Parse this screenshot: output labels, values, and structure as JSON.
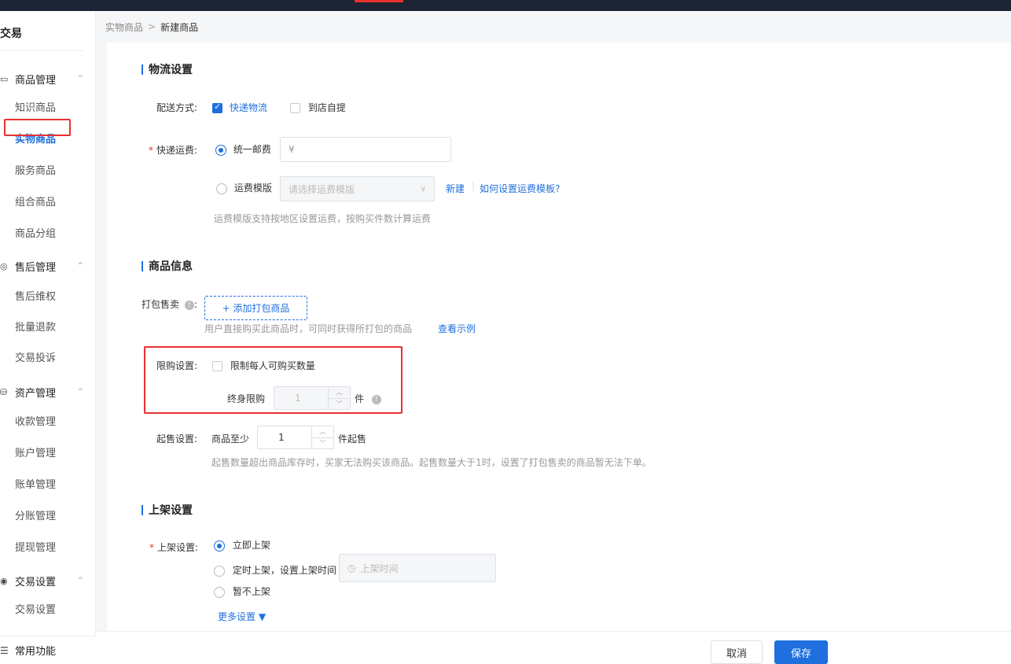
{
  "sidebar": {
    "title": "交易",
    "groups": [
      {
        "label": "商品管理",
        "icon": "▭",
        "items": [
          "知识商品",
          "实物商品",
          "服务商品",
          "组合商品",
          "商品分组"
        ]
      },
      {
        "label": "售后管理",
        "icon": "◎",
        "items": [
          "售后维权",
          "批量退款",
          "交易投诉"
        ]
      },
      {
        "label": "资产管理",
        "icon": "⛁",
        "items": [
          "收款管理",
          "账户管理",
          "账单管理",
          "分账管理",
          "提现管理"
        ]
      },
      {
        "label": "交易设置",
        "icon": "◉",
        "items": [
          "交易设置"
        ]
      }
    ],
    "bottom": {
      "label": "常用功能",
      "icon": "☰"
    },
    "chevron": "^"
  },
  "breadcrumb": {
    "parent": "实物商品",
    "separator": ">",
    "current": "新建商品"
  },
  "logistics": {
    "title": "物流设置",
    "delivery_label": "配送方式:",
    "express_option": "快递物流",
    "pickup_option": "到店自提",
    "fee_label": "快递运费:",
    "flat_fee_option": "统一邮费",
    "currency": "¥",
    "template_option": "运费模版",
    "template_placeholder": "请选择运费模版",
    "new_link": "新建",
    "help_link": "如何设置运费模板?",
    "template_hint": "运费模版支持按地区设置运费，按购买件数计算运费"
  },
  "product_info": {
    "title": "商品信息",
    "bundle_label": "打包售卖",
    "add_bundle_button": "+ 添加打包商品",
    "bundle_hint": "用户直接购买此商品时，可同时获得所打包的商品",
    "example_link": "查看示例",
    "limit_label": "限购设置:",
    "limit_checkbox": "限制每人可购买数量",
    "lifetime_label": "终身限购",
    "lifetime_value": "1",
    "unit": "件",
    "min_label": "起售设置:",
    "min_prefix": "商品至少",
    "min_value": "1",
    "min_suffix": "件起售",
    "min_hint": "起售数量超出商品库存时，买家无法购买该商品。起售数量大于1时，设置了打包售卖的商品暂无法下单。"
  },
  "shelf": {
    "title": "上架设置",
    "label": "上架设置:",
    "option_now": "立即上架",
    "option_timed": "定时上架，设置上架时间",
    "time_placeholder": "上架时间",
    "option_none": "暂不上架",
    "more": "更多设置 ▼"
  },
  "footer": {
    "cancel": "取消",
    "save": "保存"
  },
  "colors": {
    "accent": "#1f6fde",
    "highlight": "#e8312f",
    "topbar": "#1d2433"
  }
}
